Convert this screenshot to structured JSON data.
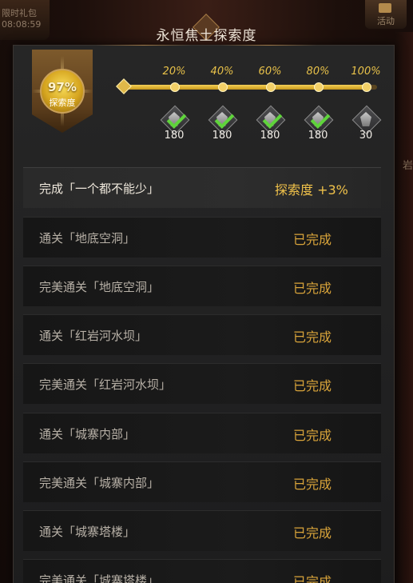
{
  "background": {
    "gift_label": "限时礼包",
    "gift_timer": "08:08:59",
    "event_label": "活动",
    "side_char": "岩"
  },
  "panel": {
    "title": "永恒焦土探索度"
  },
  "emblem": {
    "percent": "97%",
    "label": "探索度",
    "progress": 0.97
  },
  "milestones": [
    {
      "label": "20%",
      "count": "180",
      "claimed": true
    },
    {
      "label": "40%",
      "count": "180",
      "claimed": true
    },
    {
      "label": "60%",
      "count": "180",
      "claimed": true
    },
    {
      "label": "80%",
      "count": "180",
      "claimed": true
    },
    {
      "label": "100%",
      "count": "30",
      "claimed": false
    }
  ],
  "tasks": [
    {
      "name": "完成「一个都不能少」",
      "status": "探索度 +3%"
    },
    {
      "name": "通关「地底空洞」",
      "status": "已完成"
    },
    {
      "name": "完美通关「地底空洞」",
      "status": "已完成"
    },
    {
      "name": "通关「红岩河水坝」",
      "status": "已完成"
    },
    {
      "name": "完美通关「红岩河水坝」",
      "status": "已完成"
    },
    {
      "name": "通关「城寨内部」",
      "status": "已完成"
    },
    {
      "name": "完美通关「城寨内部」",
      "status": "已完成"
    },
    {
      "name": "通关「城寨塔楼」",
      "status": "已完成"
    },
    {
      "name": "完美通关「城寨塔楼」",
      "status": "已完成"
    }
  ],
  "colors": {
    "gold": "#e9c24a",
    "check_green": "#5fd43b",
    "done_text": "#d9a43a"
  }
}
